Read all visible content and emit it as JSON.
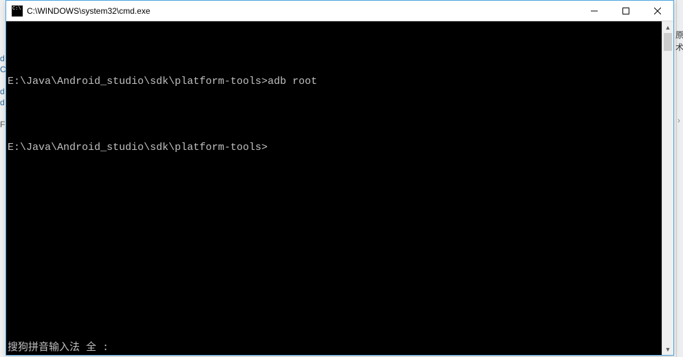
{
  "window": {
    "title": "C:\\WINDOWS\\system32\\cmd.exe"
  },
  "terminal": {
    "lines": [
      {
        "prompt": "E:\\Java\\Android_studio\\sdk\\platform-tools>",
        "command": "adb root"
      },
      {
        "blank": true
      },
      {
        "prompt": "E:\\Java\\Android_studio\\sdk\\platform-tools>",
        "command": ""
      }
    ],
    "ime_status": "搜狗拼音输入法 全 :"
  },
  "bg": {
    "left_chars": [
      "d",
      "C",
      "d",
      "d",
      "F"
    ],
    "right_chars": [
      "原",
      "术"
    ]
  }
}
